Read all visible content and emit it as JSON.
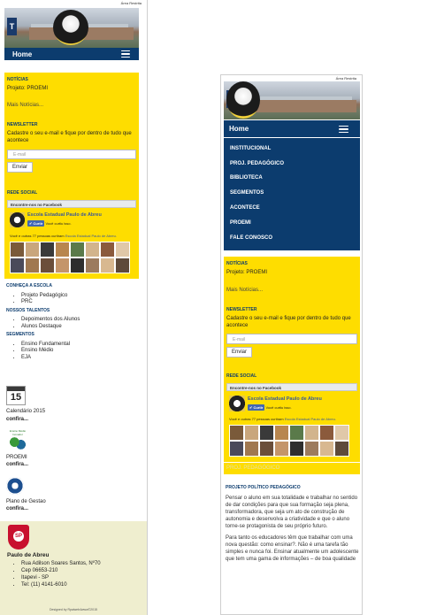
{
  "header": {
    "area_restrita": "Área Restrita",
    "home": "Home"
  },
  "menu": {
    "items": [
      "INSTITUCIONAL",
      "PROJ. PEDAGÓGICO",
      "BIBLIOTECA",
      "SEGMENTOS",
      "ACONTECE",
      "PROEMI",
      "FALE CONOSCO"
    ]
  },
  "noticias": {
    "title": "NOTÍCIAS",
    "item": "Projeto: PROEMI",
    "more": "Mais Notícias..."
  },
  "newsletter": {
    "title": "NEWSLETTER",
    "text": "Cadastre o seu e-mail e fique por dentro de tudo que acontece",
    "placeholder": "E-mail",
    "button": "Enviar"
  },
  "social": {
    "title": "REDE SOCIAL",
    "bar": "Encontre-nos no Facebook",
    "page_name": "Escola Estadual Paulo de Abreu",
    "like_button": "Curtir",
    "liked_text": "Você curtiu isso.",
    "likes_text": "Você e outras 77 pessoas curtiram",
    "likes_page": "Escola Estadual Paulo de Abreu."
  },
  "sidebar": {
    "conheca": {
      "title": "CONHEÇA A ESCOLA",
      "items": [
        "Projeto Pedagógico",
        "PRC"
      ]
    },
    "talentos": {
      "title": "NOSSOS TALENTOS",
      "items": [
        "Depoimentos dos Alunos",
        "Alunos Destaque"
      ]
    },
    "segmentos": {
      "title": "SEGMENTOS",
      "items": [
        "Ensino Fundamental",
        "Ensino Médio",
        "EJA"
      ]
    }
  },
  "widgets": {
    "calendar": {
      "number": "15",
      "label": "Calendário 2015",
      "link": "confira..."
    },
    "proemi": {
      "logo_text": "Ensino Médio Inovador",
      "label": "PROEMI",
      "link": "confira..."
    },
    "plano": {
      "label": "Plano de Gestao",
      "link": "confira..."
    }
  },
  "footer": {
    "school": "Paulo de Abreu",
    "address": [
      "Rua Adilson Soares Santos, Nº70",
      "Cep 06653-210",
      "Itapevi - SP",
      "Tel: (11) 4141-6010"
    ],
    "credit": "Designed by Rpaiweb4www©2015"
  },
  "right": {
    "proj_tab": "PROJ. PEDAGÓGICO",
    "article_title": "PROJETO POLÍTICO PEDAGÓGICO",
    "p1": "Pensar o aluno em sua totalidade e trabalhar no sentido de dar condições para que sua formação seja plena, transformadora, que seja um ato de construção de autonomia e desenvolva a criatividade e que o aluno torne-se protagonista de seu próprio futuro.",
    "p2": "Para tanto os educadores têm que trabalhar com uma nova questão: como ensinar?. Não é uma tarefa tão simples e nunca foi. Ensinar atualmente um adolescente que tem uma gama de informações – de boa qualidade"
  },
  "colors": {
    "navy": "#0c3c6e",
    "yellow": "#fedd00",
    "footer_bg": "#efeecf"
  }
}
